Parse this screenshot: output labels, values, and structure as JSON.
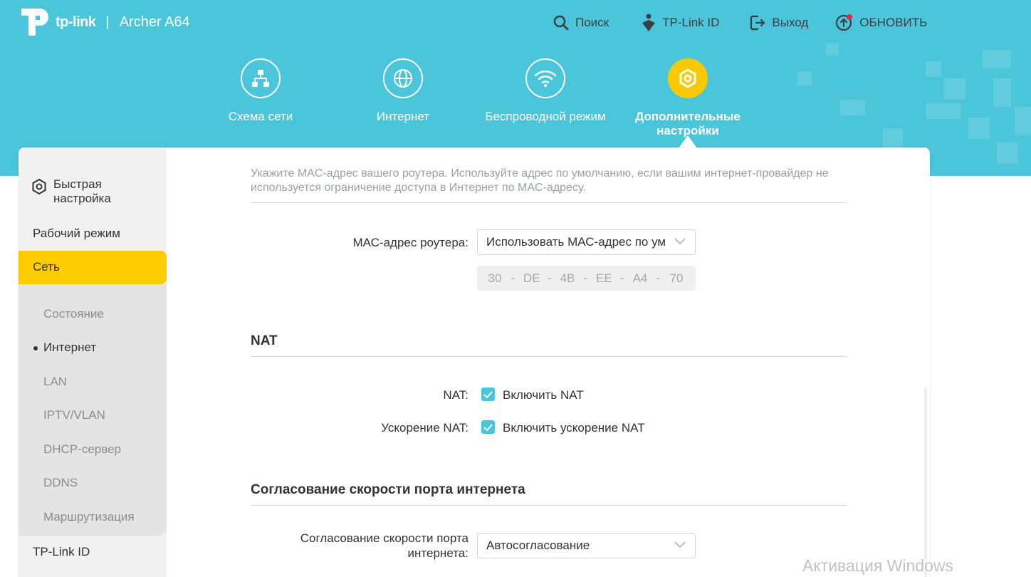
{
  "header": {
    "brand": "tp-link",
    "separator": "|",
    "model": "Archer A64",
    "accent_color": "#4ac5d9",
    "top_nav": [
      {
        "label": "Поиск",
        "icon": "search-icon"
      },
      {
        "label": "TP-Link ID",
        "icon": "tplink-id-icon"
      },
      {
        "label": "Выход",
        "icon": "logout-icon"
      },
      {
        "label": "ОБНОВИТЬ",
        "icon": "update-icon"
      }
    ]
  },
  "main_nav": {
    "tabs": [
      {
        "label": "Схема сети",
        "icon": "network-map-icon"
      },
      {
        "label": "Интернет",
        "icon": "globe-icon"
      },
      {
        "label": "Беспроводной режим",
        "icon": "wifi-icon"
      },
      {
        "label": "Дополнительные настройки",
        "icon": "advanced-gear-icon",
        "active": true
      }
    ],
    "active_color": "#f8c900"
  },
  "sidebar": {
    "quick_setup": "Быстрая настройка",
    "operation_mode": "Рабочий режим",
    "network": "Сеть",
    "network_color": "#fccc00",
    "sub_items": [
      "Состояние",
      "Интернет",
      "LAN",
      "IPTV/VLAN",
      "DHCP-сервер",
      "DDNS",
      "Маршрутизация"
    ],
    "active_sub": "Интернет",
    "tplink_id": "TP-Link ID"
  },
  "content": {
    "mac_description": "Укажите MAC-адрес вашего роутера. Используйте адрес по умолчанию, если вашим интернет-провайдер не используется ограничение доступа в Интернет по MAC-адресу.",
    "mac_label": "МАС-адрес роутера:",
    "mac_select_value": "Использовать МАС-адрес по умолчанию",
    "mac_octets": [
      "30",
      "DE",
      "4B",
      "EE",
      "A4",
      "70"
    ],
    "nat_section_title": "NAT",
    "nat_label": "NAT:",
    "nat_checkbox_label": "Включить NAT",
    "nat_checked": true,
    "nat_accel_label": "Ускорение NAT:",
    "nat_accel_checkbox_label": "Включить ускорение NAT",
    "nat_accel_checked": true,
    "port_speed_section_title": "Согласование скорости порта интернета",
    "port_speed_label_line1": "Согласование скорости порта",
    "port_speed_label_line2": "интернета:",
    "port_speed_value": "Автосогласование"
  },
  "watermark": "Активация Windows"
}
